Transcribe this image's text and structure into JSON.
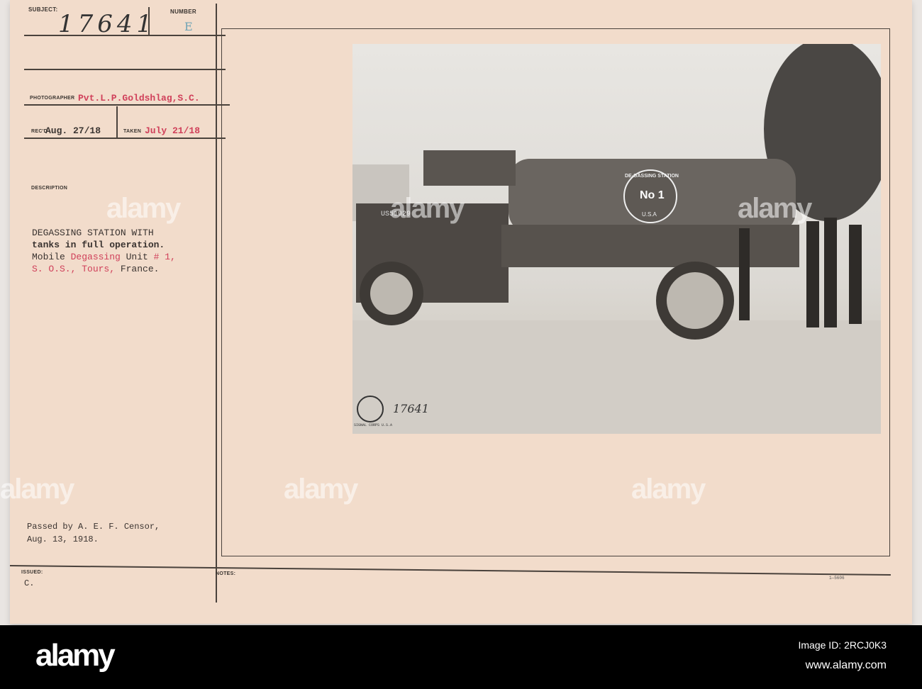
{
  "card": {
    "subject_label": "SUBJECT:",
    "subject_value": "17641",
    "number_label": "NUMBER",
    "number_value": "E",
    "photographer_label": "PHOTOGRAPHER",
    "photographer_value": "Pvt.L.P.Goldshlag,S.C.",
    "recd_label": "REC'D",
    "recd_value": "Aug. 27/18",
    "taken_label": "TAKEN",
    "taken_value": "July 21/18",
    "description_label": "DESCRIPTION",
    "description": {
      "line1": "DEGASSING STATION WITH",
      "line2": "tanks in full operation.",
      "line3a": "Mobile ",
      "line3b": "Degassing",
      "line3c": " Unit ",
      "line3d": "# 1,",
      "line4a": "S. O.S., Tours,",
      "line4b": " France."
    },
    "censor_line1": "Passed by A. E. F. Censor,",
    "censor_line2": "Aug. 13, 1918.",
    "issued_label": "ISSUED:",
    "issued_value": "C.",
    "notes_label": "NOTES:",
    "form_number": "1—5606"
  },
  "photo": {
    "plate": "US51029",
    "tank_text_top": "DE-GASSING STATION",
    "tank_no": "No 1",
    "tank_usa": "U.S.A",
    "stamp_text": "SIGNAL CORPS U.S.A",
    "negative_number": "17641"
  },
  "watermark": "alamy",
  "footer": {
    "logo": "alamy",
    "image_id": "Image ID: 2RCJ0K3",
    "url": "www.alamy.com"
  }
}
